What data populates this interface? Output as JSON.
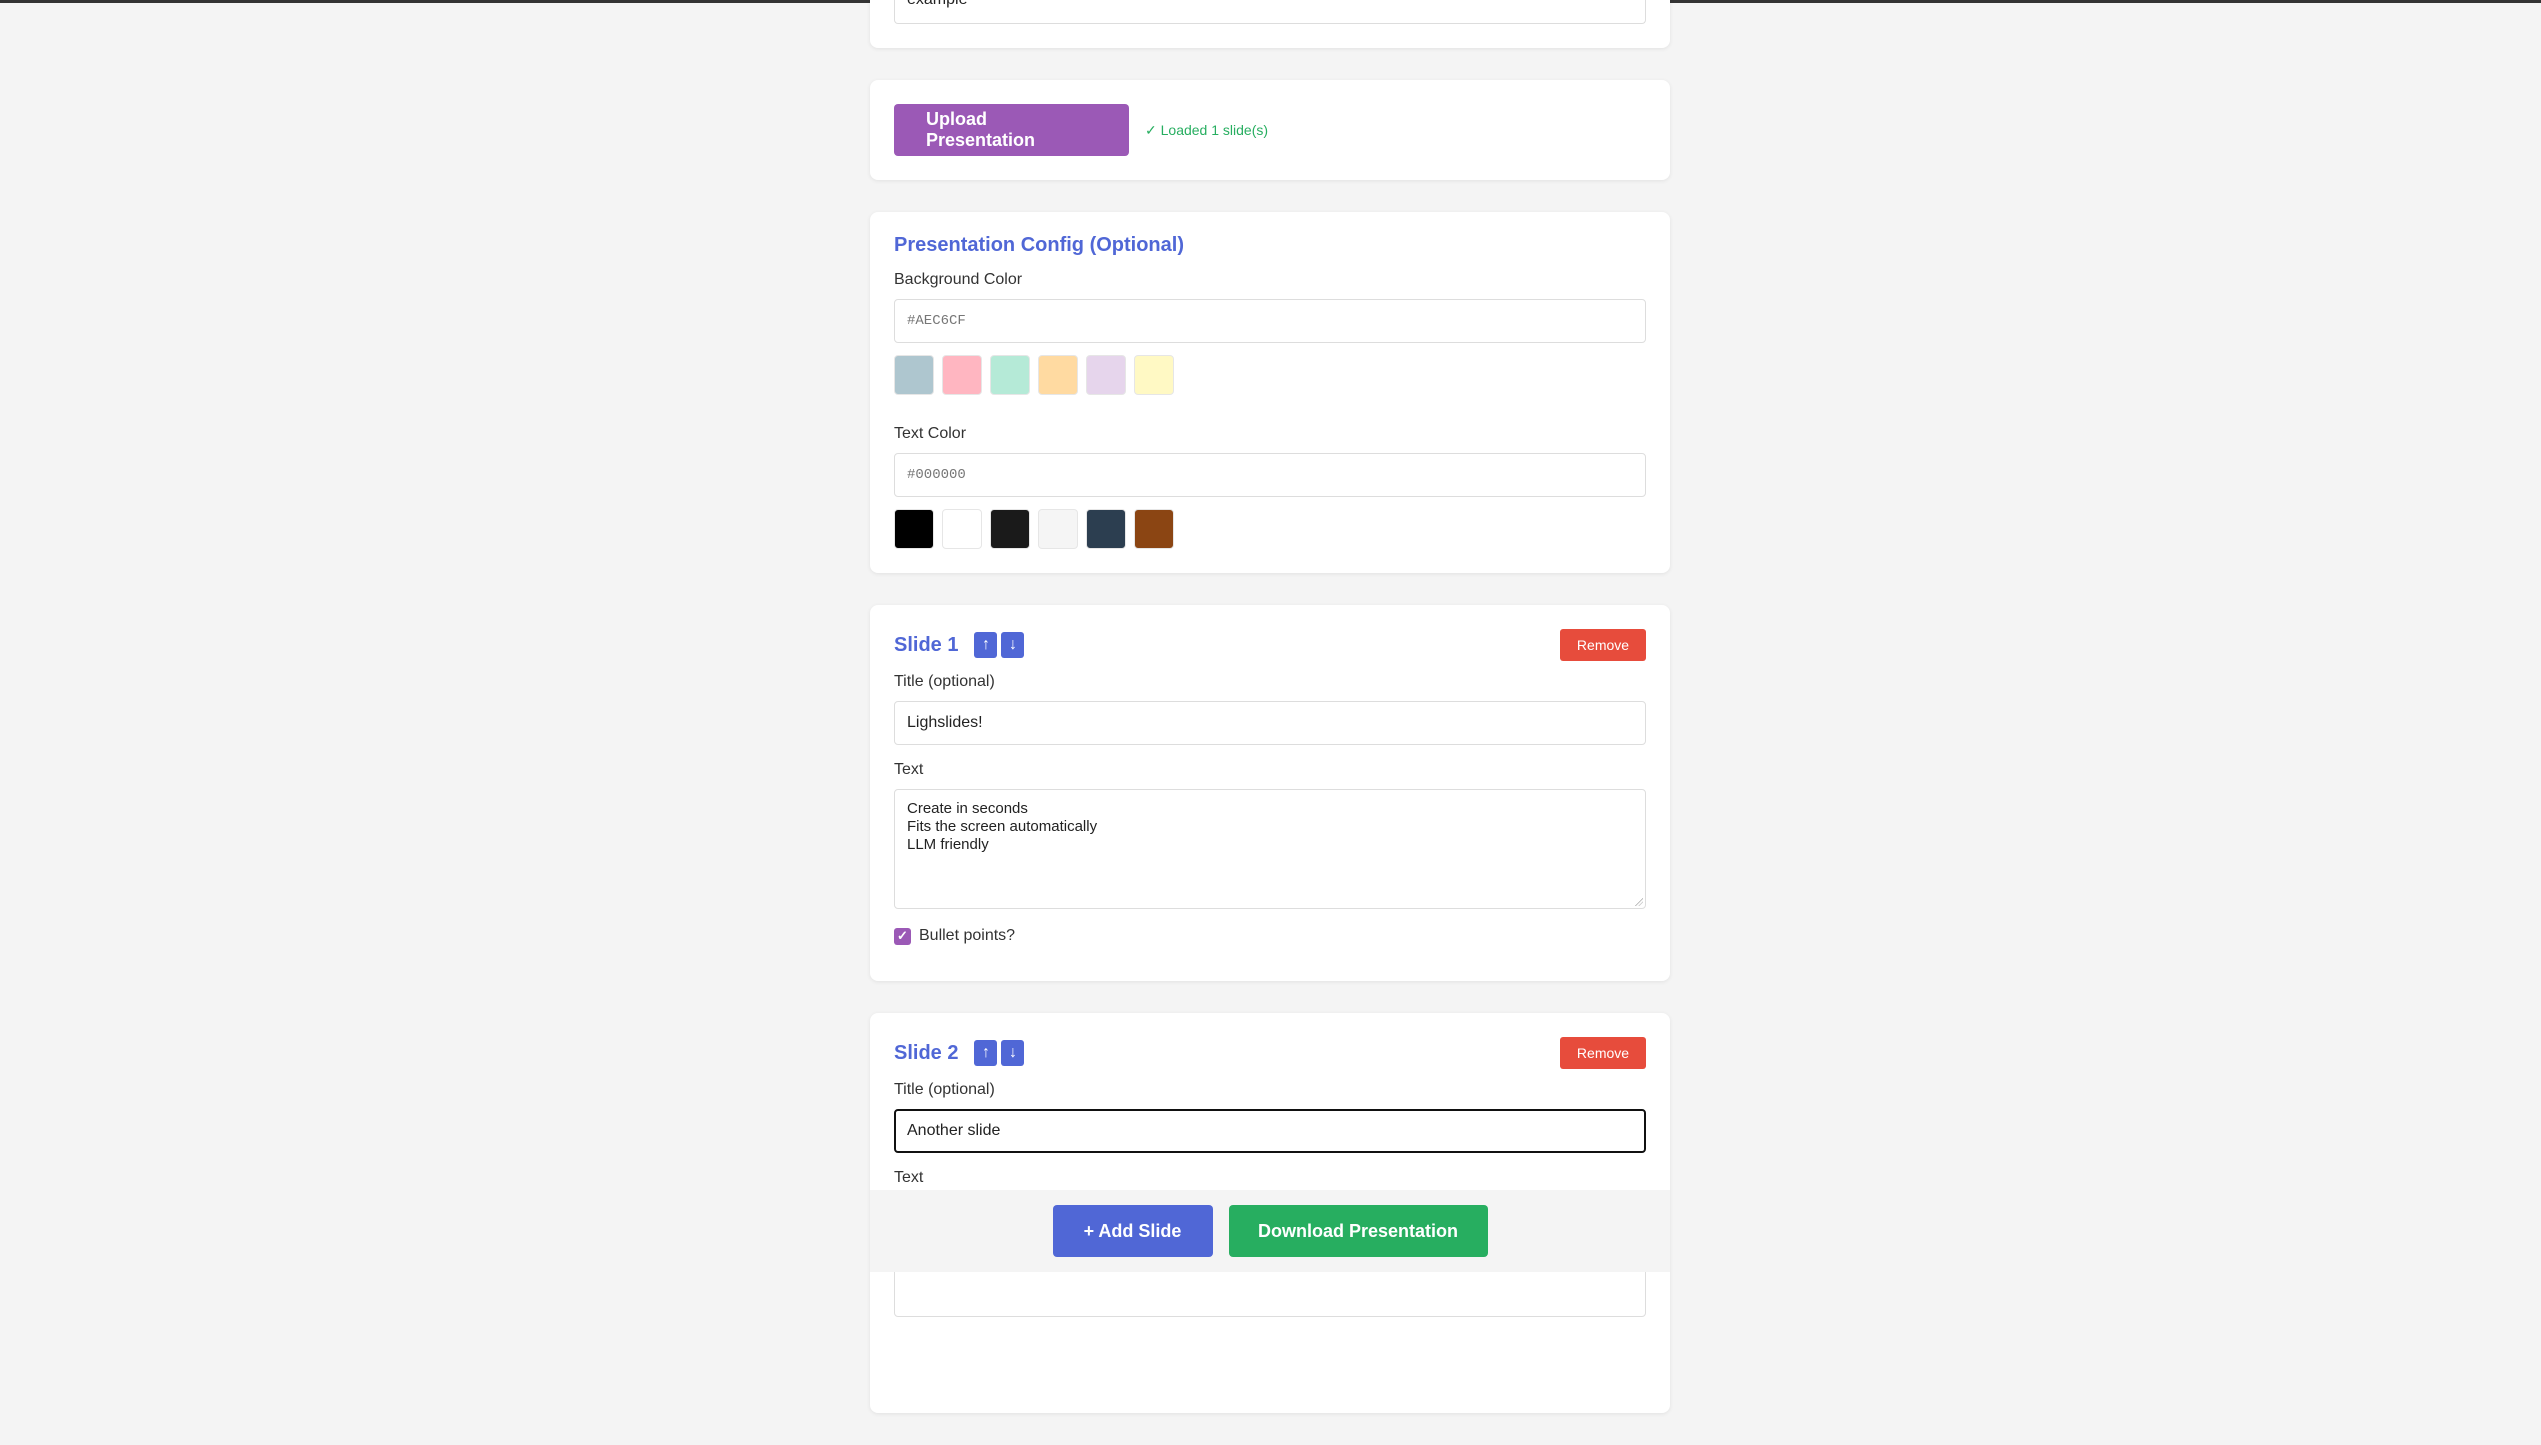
{
  "top_card": {
    "input_value": "example"
  },
  "upload": {
    "button_label": "Upload Presentation",
    "status": "✓ Loaded 1 slide(s)"
  },
  "config": {
    "title": "Presentation Config (Optional)",
    "background_label": "Background Color",
    "background_placeholder": "#AEC6CF",
    "background_swatches": [
      "#AEC6CF",
      "#FFB6C1",
      "#B5EAD7",
      "#FFDAA1",
      "#E6D5EC",
      "#FFF9C4"
    ],
    "text_label": "Text Color",
    "text_placeholder": "#000000",
    "text_swatches": [
      "#000000",
      "#FFFFFF",
      "#1A1A1A",
      "#F5F5F5",
      "#2C3E50",
      "#8B4513"
    ]
  },
  "slides": [
    {
      "heading": "Slide 1",
      "up_arrow": "↑",
      "down_arrow": "↓",
      "remove_label": "Remove",
      "title_label": "Title (optional)",
      "title_value": "Lighslides!",
      "text_label": "Text",
      "text_lines": [
        "Create in seconds",
        "Fits the screen automatically",
        "LLM friendly"
      ],
      "bullets_label": "Bullet points?",
      "bullets_checked": true
    },
    {
      "heading": "Slide 2",
      "up_arrow": "↑",
      "down_arrow": "↓",
      "remove_label": "Remove",
      "title_label": "Title (optional)",
      "title_value": "Another slide",
      "text_label": "Text"
    }
  ],
  "bottom_bar": {
    "add_label": "+ Add Slide",
    "download_label": "Download Presentation"
  },
  "colors": {
    "accent_blue": "#5067d6",
    "purple": "#9b59b6",
    "green": "#27ae60",
    "red": "#e74c3c"
  }
}
